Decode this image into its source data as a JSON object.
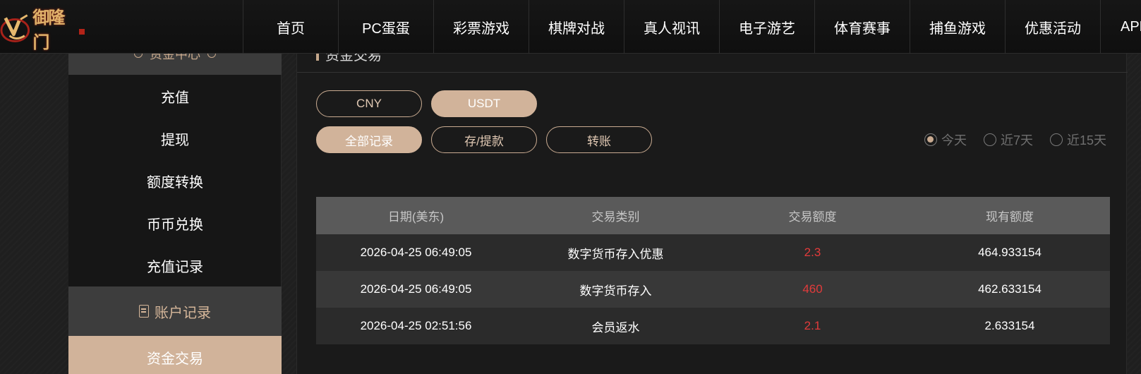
{
  "brand": {
    "logo_text": "御隆门"
  },
  "nav": {
    "items": [
      "首页",
      "PC蛋蛋",
      "彩票游戏",
      "棋牌对战",
      "真人视讯",
      "电子游艺",
      "体育赛事",
      "捕鱼游戏",
      "优惠活动",
      "APP"
    ]
  },
  "sidebar": {
    "section_top_label": "资金中心",
    "items": [
      "充值",
      "提现",
      "额度转换",
      "币币兑换",
      "充值记录"
    ],
    "group_label": "账户记录",
    "active_item": "资金交易"
  },
  "main": {
    "header_title": "资金交易",
    "currency_tabs": [
      {
        "label": "CNY",
        "selected": false
      },
      {
        "label": "USDT",
        "selected": true
      }
    ],
    "type_tabs": [
      {
        "label": "全部记录",
        "selected": true
      },
      {
        "label": "存/提款",
        "selected": false
      },
      {
        "label": "转账",
        "selected": false
      }
    ],
    "date_filters": [
      {
        "label": "今天",
        "checked": true
      },
      {
        "label": "近7天",
        "checked": false
      },
      {
        "label": "近15天",
        "checked": false
      }
    ],
    "table": {
      "headers": [
        "日期(美东)",
        "交易类别",
        "交易额度",
        "现有额度"
      ],
      "rows": [
        [
          "2026-04-25 06:49:05",
          "数字货币存入优惠",
          "2.3",
          "464.933154"
        ],
        [
          "2026-04-25 06:49:05",
          "数字货币存入",
          "460",
          "462.633154"
        ],
        [
          "2026-04-25 02:51:56",
          "会员返水",
          "2.1",
          "2.633154"
        ]
      ]
    }
  },
  "colors": {
    "accent": "#d1b39a",
    "amount_red": "#e23b3b",
    "table_header": "#5a5a5a"
  }
}
